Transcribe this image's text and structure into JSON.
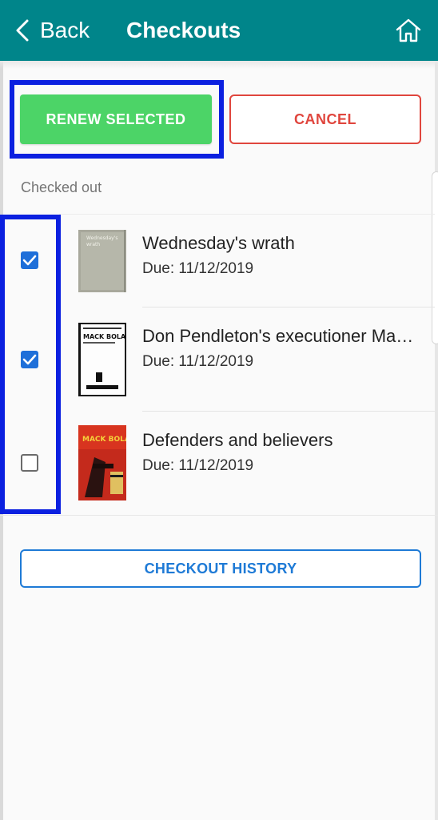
{
  "header": {
    "back_label": "Back",
    "title": "Checkouts",
    "bar_color": "#00858a"
  },
  "actions": {
    "renew_label": "RENEW SELECTED",
    "cancel_label": "CANCEL",
    "renew_color": "#4cd467",
    "cancel_color": "#e0463e"
  },
  "section": {
    "label": "Checked out"
  },
  "items": [
    {
      "title": "Wednesday's wrath",
      "due": "Due: 11/12/2019",
      "selected": true,
      "cover_text": "Wednesday's wrath"
    },
    {
      "title": "Don Pendleton's executioner Ma…",
      "due": "Due: 11/12/2019",
      "selected": true,
      "cover_text": "MACK BOLAN"
    },
    {
      "title": "Defenders and believers",
      "due": "Due: 11/12/2019",
      "selected": false,
      "cover_text": "MACK BOLAN"
    }
  ],
  "footer": {
    "history_label": "CHECKOUT HISTORY",
    "history_color": "#1e7ad6"
  },
  "highlight_color": "#0b20e0"
}
